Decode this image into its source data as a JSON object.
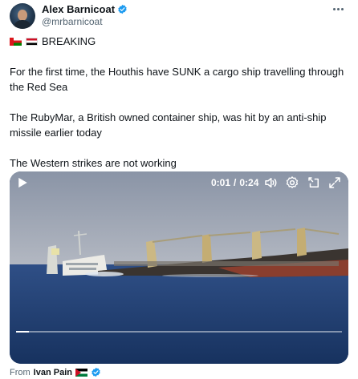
{
  "author": {
    "display_name": "Alex Barnicoat",
    "handle": "@mrbarnicoat",
    "verified_icon": "verified-badge-icon"
  },
  "tweet": {
    "breaking_flags": [
      "oman-flag",
      "yemen-flag"
    ],
    "breaking_label": "BREAKING",
    "paragraph_1": "For the first time, the Houthis have SUNK a cargo ship travelling through the Red Sea",
    "paragraph_2": "The RubyMar, a British owned container ship, was hit by an anti-ship missile earlier today",
    "paragraph_3": "The Western strikes are not working"
  },
  "video": {
    "current_time": "0:01",
    "separator": "/",
    "duration": "0:24",
    "progress": 0.04,
    "icons": [
      "play-icon",
      "volume-icon",
      "settings-icon",
      "pip-icon",
      "fullscreen-icon"
    ]
  },
  "source": {
    "from_label": "From",
    "name": "Ivan Pain",
    "flag": "palestine-flag"
  },
  "colors": {
    "verified": "#1d9bf0",
    "secondary_text": "#536471",
    "primary_text": "#0f1419"
  }
}
